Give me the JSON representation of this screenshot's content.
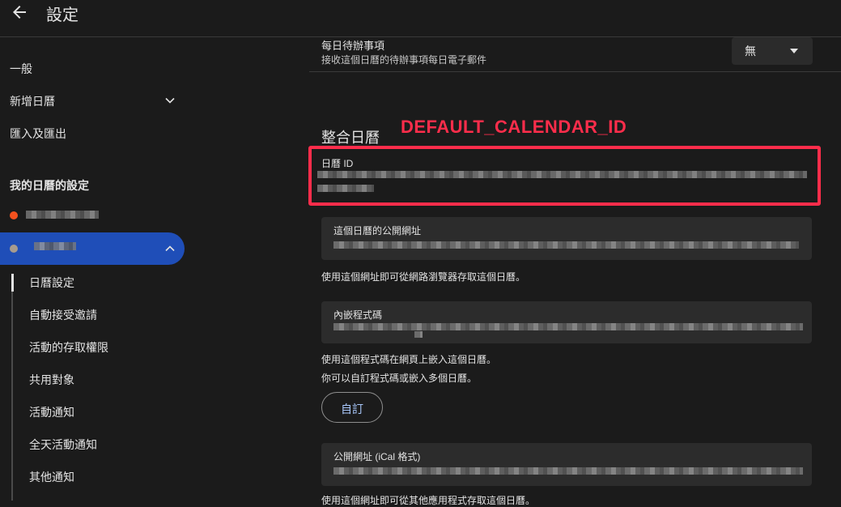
{
  "header": {
    "title": "設定",
    "back_icon": "arrow-left-icon"
  },
  "sidebar": {
    "items": [
      {
        "label": "一般"
      },
      {
        "label": "新增日曆"
      },
      {
        "label": "匯入及匯出"
      }
    ],
    "my_calendars_heading": "我的日曆的設定",
    "calendars": [
      {
        "color": "#f4511e",
        "active": false
      },
      {
        "color": "#a79b8e",
        "active": true
      }
    ],
    "sub_items": [
      {
        "label": "日曆設定"
      },
      {
        "label": "自動接受邀請"
      },
      {
        "label": "活動的存取權限"
      },
      {
        "label": "共用對象"
      },
      {
        "label": "活動通知"
      },
      {
        "label": "全天活動通知"
      },
      {
        "label": "其他通知"
      }
    ]
  },
  "main": {
    "daily_agenda": {
      "label": "每日待辦事項",
      "description": "接收這個日曆的待辦事項每日電子郵件",
      "select_value": "無"
    },
    "integrate": {
      "title": "整合日曆",
      "annotation": "DEFAULT_CALENDAR_ID",
      "calendar_id_label": "日曆 ID",
      "public_url_label": "這個日曆的公開網址",
      "public_url_help": "使用這個網址即可從網路瀏覽器存取這個日曆。",
      "embed_label": "內嵌程式碼",
      "embed_help_1": "使用這個程式碼在網頁上嵌入這個日曆。",
      "embed_help_2": "你可以自訂程式碼或嵌入多個日曆。",
      "customize_button": "自訂",
      "ical_label": "公開網址 (iCal 格式)",
      "ical_help": "使用這個網址即可從其他應用程式存取這個日曆。"
    }
  },
  "colors": {
    "accent": "#a8c7fa",
    "active_nav": "#1f4eb8",
    "annotation": "#ff2d4b"
  }
}
